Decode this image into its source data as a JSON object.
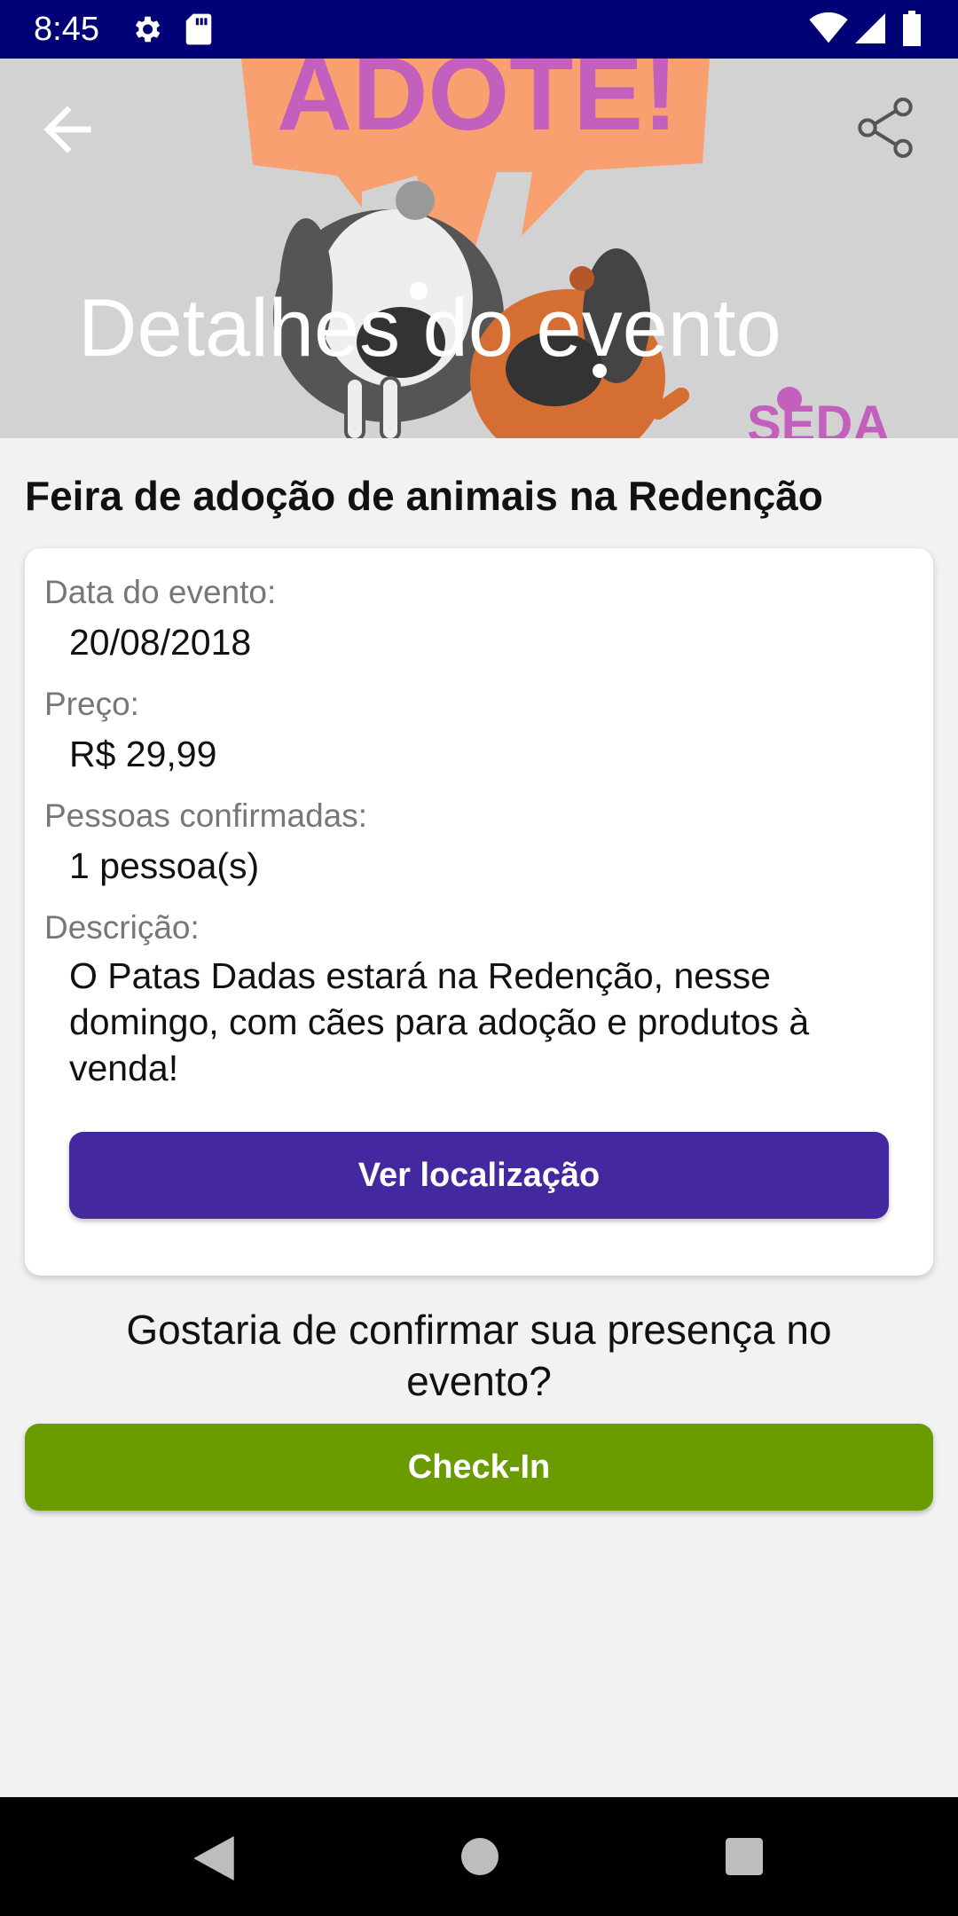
{
  "status_bar": {
    "time": "8:45",
    "icons": [
      "gear-icon",
      "sd-card-icon",
      "wifi-icon",
      "signal-icon",
      "battery-icon"
    ]
  },
  "header": {
    "title": "Detalhes do evento",
    "banner_text": "ADOTE!",
    "banner_logo_text": "SEDA",
    "back_icon": "arrow-left-icon",
    "share_icon": "share-icon"
  },
  "event": {
    "name": "Feira de adoção de animais na Redenção",
    "date_label": "Data do evento:",
    "date": "20/08/2018",
    "price_label": "Preço:",
    "price": "R$ 29,99",
    "confirmed_label": "Pessoas confirmadas:",
    "confirmed": "1 pessoa(s)",
    "description_label": "Descrição:",
    "description": "O Patas Dadas estará na Redenção, nesse domingo, com cães para adoção e produtos à venda!",
    "location_button": "Ver localização"
  },
  "checkin": {
    "question": "Gostaria de confirmar sua presença no evento?",
    "button": "Check-In"
  },
  "colors": {
    "status_bar": "#020277",
    "location_button": "#44289f",
    "checkin_button": "#6a9c00",
    "background": "#f2f2f2"
  },
  "nav_bar": {
    "icons": [
      "nav-back-icon",
      "nav-home-icon",
      "nav-recents-icon"
    ]
  }
}
